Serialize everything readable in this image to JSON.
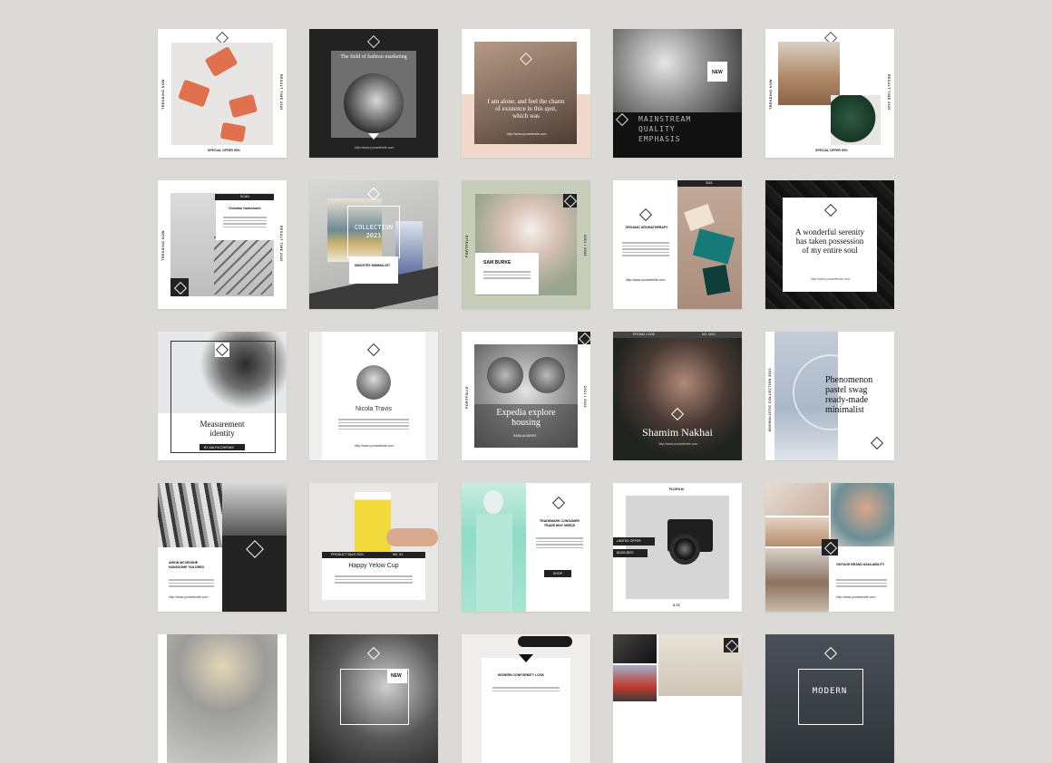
{
  "background_color": "#dcdad6",
  "tiles": {
    "t1": {
      "side_left": "TRENDING NOW",
      "side_right": "RESULT TIME 2020",
      "footer": "SPECIAL OFFER 50%"
    },
    "t2": {
      "title": "The field of fashion marketing",
      "url": "http://www.yourwebsite.com"
    },
    "t3": {
      "title": "I am alone, and feel the charm of existence in this spot, which was",
      "url": "http://www.yourwebsite.com"
    },
    "t4": {
      "badge": "NEW",
      "title": "MAINSTREAM QUALITY EMPHASIS"
    },
    "t5": {
      "side_left": "TRENDING NOW",
      "side_right": "RESULT TIME 2020",
      "footer": "SPECIAL OFFER 50%"
    },
    "t6": {
      "tab": "SCAN",
      "title": "Christian Gartenbach",
      "side_left": "TRENDING NOW",
      "side_right": "RESULT TIME 2020"
    },
    "t7": {
      "title": "COLLECTION 2021",
      "subtitle": "INDUSTRY MINIMALIST"
    },
    "t8": {
      "title": "SAM BURKE",
      "side_left": "PORTFOLIO",
      "side_right": "2021 / 2022"
    },
    "t9": {
      "tag": "2021",
      "title": "ORGANIC AROMATHERAPY",
      "url": "http://www.yourwebsite.com"
    },
    "t10": {
      "title": "A wonderful serenity has taken possession of my entire soul",
      "url": "http://www.yourwebsite.com"
    },
    "t11": {
      "title": "Measurement identity",
      "footer": "BY AALIYA DHIRANI"
    },
    "t12": {
      "name": "Nicola Travis",
      "url": "http://www.yourwebsite.com"
    },
    "t13": {
      "title": "Expedia explore housing",
      "footer": "SASA ALVAREZ",
      "side_left": "PORTFOLIO",
      "side_right": "2021 / 2022"
    },
    "t14": {
      "header_left": "PROMO CODE",
      "header_right": "NO. 0001",
      "title": "Shamim Nakhai",
      "url": "http://www.yourwebsite.com"
    },
    "t15": {
      "title": "Phenomenon pastel swag ready-made minimalist",
      "side_left": "MINIMALISTIC COLLECTION 2021"
    },
    "t16": {
      "title": "AIRON MCVENSHE HANDSOME TAILORED",
      "url": "http://www.yourwebsite.com"
    },
    "t17": {
      "title": "Happy Yelow Cup",
      "bar_left": "PRODUCT SALE 2021",
      "bar_right": "NO. 01"
    },
    "t18": {
      "title": "TRADEMARK CONSUMER TRADE WHY NEEDS",
      "button": "SHOP"
    },
    "t19": {
      "brand": "FUJIFILM",
      "offer": "LIMITED OFFER",
      "price": "$1000 $870",
      "footer": "X-T3"
    },
    "t20": {
      "title": "VINTAGE BRAND AVAILABILITY",
      "url": "http://www.yourwebsite.com"
    },
    "t21": {},
    "t22": {
      "badge": "NEW"
    },
    "t23": {
      "title": "MODERN CONFORMITY LOOK"
    },
    "t24": {},
    "t25": {
      "title": "MODERN"
    }
  }
}
